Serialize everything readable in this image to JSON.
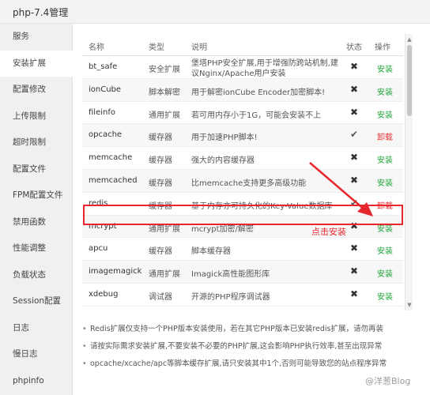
{
  "window": {
    "title": "php-7.4管理"
  },
  "sidebar": {
    "items": [
      {
        "label": "服务"
      },
      {
        "label": "安装扩展"
      },
      {
        "label": "配置修改"
      },
      {
        "label": "上传限制"
      },
      {
        "label": "超时限制"
      },
      {
        "label": "配置文件"
      },
      {
        "label": "FPM配置文件"
      },
      {
        "label": "禁用函数"
      },
      {
        "label": "性能调整"
      },
      {
        "label": "负载状态"
      },
      {
        "label": "Session配置"
      },
      {
        "label": "日志"
      },
      {
        "label": "慢日志"
      },
      {
        "label": "phpinfo"
      }
    ],
    "active_index": 1
  },
  "table": {
    "headers": {
      "name": "名称",
      "type": "类型",
      "desc": "说明",
      "status": "状态",
      "op": "操作"
    },
    "rows": [
      {
        "name": "bt_safe",
        "type": "安全扩展",
        "desc": "堡塔PHP安全扩展,用于增强防跨站机制,建议Nginx/Apache用户安装",
        "status": "✖",
        "op": "安装"
      },
      {
        "name": "ionCube",
        "type": "脚本解密",
        "desc": "用于解密ionCube Encoder加密脚本!",
        "status": "✖",
        "op": "安装"
      },
      {
        "name": "fileinfo",
        "type": "通用扩展",
        "desc": "若可用内存小于1G，可能会安装不上",
        "status": "✖",
        "op": "安装"
      },
      {
        "name": "opcache",
        "type": "缓存器",
        "desc": "用于加速PHP脚本!",
        "status": "✔",
        "op": "卸载"
      },
      {
        "name": "memcache",
        "type": "缓存器",
        "desc": "强大的内容缓存器",
        "status": "✖",
        "op": "安装"
      },
      {
        "name": "memcached",
        "type": "缓存器",
        "desc": "比memcache支持更多高级功能",
        "status": "✖",
        "op": "安装"
      },
      {
        "name": "redis",
        "type": "缓存器",
        "desc": "基于内存亦可持久化的Key-Value数据库",
        "status": "✔",
        "op": "卸载"
      },
      {
        "name": "mcrypt",
        "type": "通用扩展",
        "desc": "mcrypt加密/解密",
        "status": "✖",
        "op": "安装"
      },
      {
        "name": "apcu",
        "type": "缓存器",
        "desc": "脚本缓存器",
        "status": "✖",
        "op": "安装"
      },
      {
        "name": "imagemagick",
        "type": "通用扩展",
        "desc": "Imagick高性能图形库",
        "status": "✖",
        "op": "安装"
      },
      {
        "name": "xdebug",
        "type": "调试器",
        "desc": "开源的PHP程序调试器",
        "status": "✖",
        "op": "安装"
      }
    ]
  },
  "annotation": {
    "text": "点击安装"
  },
  "notes": [
    "Redis扩展仅支持一个PHP版本安装使用，若在其它PHP版本已安装redis扩展，请勿再装",
    "请按实际需求安装扩展,不要安装不必要的PHP扩展,这会影响PHP执行效率,甚至出现异常",
    "opcache/xcache/apc等脚本缓存扩展,请只安装其中1个,否则可能导致您的站点程序异常"
  ],
  "watermark": "@洋葱Blog",
  "colors": {
    "install": "#20a53a",
    "uninstall": "#e33333",
    "annotation": "#e8262d"
  }
}
